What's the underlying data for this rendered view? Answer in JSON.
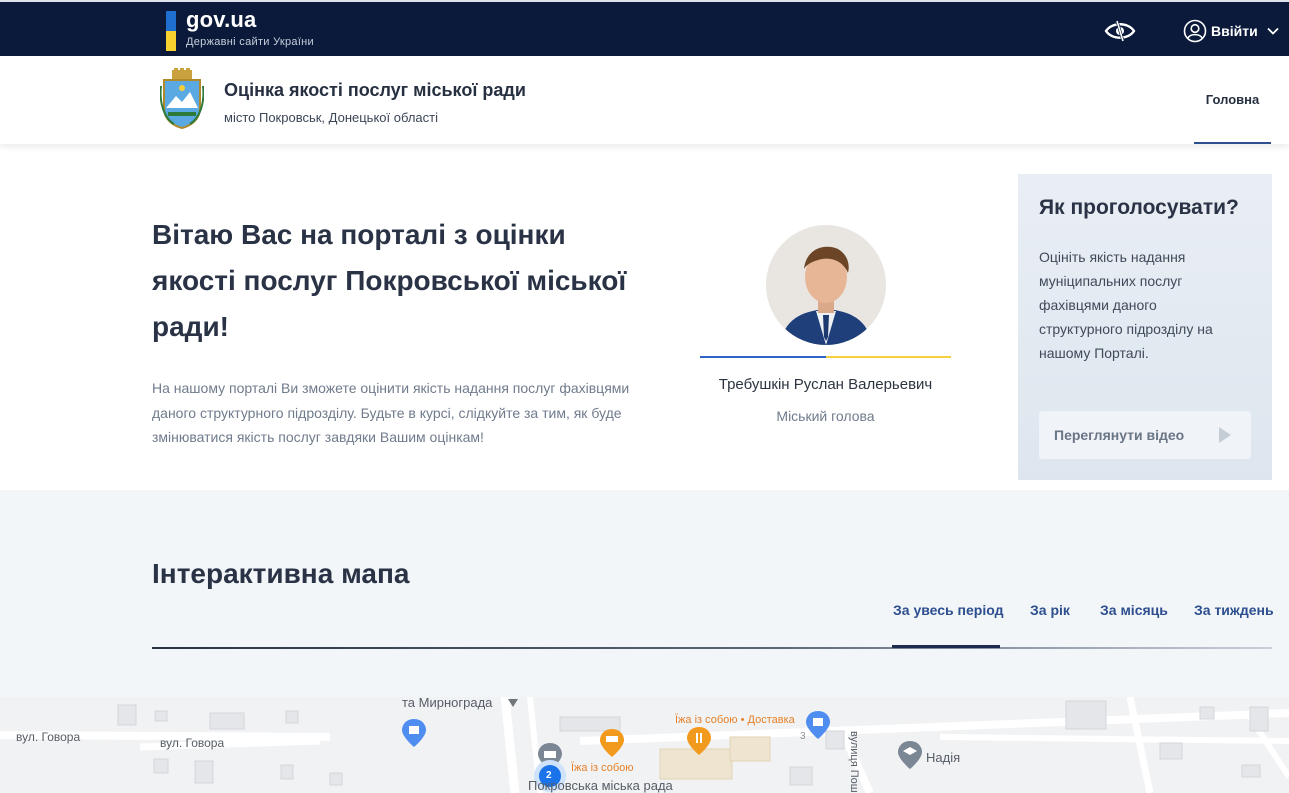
{
  "govbar": {
    "logo": "gov.ua",
    "subtitle": "Державні сайти України",
    "login_label": "Ввійти",
    "accessibility_icon": "eye-accessibility-icon",
    "flag_colors": [
      "#1f6fd1",
      "#f5d22e"
    ]
  },
  "header": {
    "title": "Оцінка якості послуг міської ради",
    "subtitle": "місто Покровськ, Донецької області",
    "nav_home": "Головна"
  },
  "hero": {
    "title": "Вітаю Вас на порталі з оцінки якості послуг Покровської міської ради!",
    "text": "На нашому порталі Ви зможете оцінити якість надання послуг фахівцями даного структурного підрозділу. Будьте в курсі, слідкуйте за тим, як буде змінюватися якість послуг завдяки Вашим оцінкам!"
  },
  "mayor": {
    "name": "Требушкін Руслан Валерьевич",
    "role": "Міський голова"
  },
  "howto": {
    "title": "Як проголосувати?",
    "text": "Оцініть якість надання муніципальних послуг фахівцями даного структурного підрозділу на нашому Порталі.",
    "video_button": "Переглянути відео"
  },
  "map_section": {
    "title": "Інтерактивна мапа",
    "tabs": [
      "За увесь період",
      "За рік",
      "За місяць",
      "За тиждень"
    ],
    "active_tab": 0
  },
  "map": {
    "labels": {
      "street1": "вул. Говора",
      "street2": "вул. Говора",
      "road_to": "та Мирнограда",
      "poi_food": "Їжа із собою",
      "poi_food_delivery": "Їжа із собою • Доставка",
      "council": "Покровська міська рада",
      "nadiya": "Надія",
      "street_vertical": "вулиця Пош",
      "building_num": "3",
      "cluster_count": "2"
    }
  }
}
